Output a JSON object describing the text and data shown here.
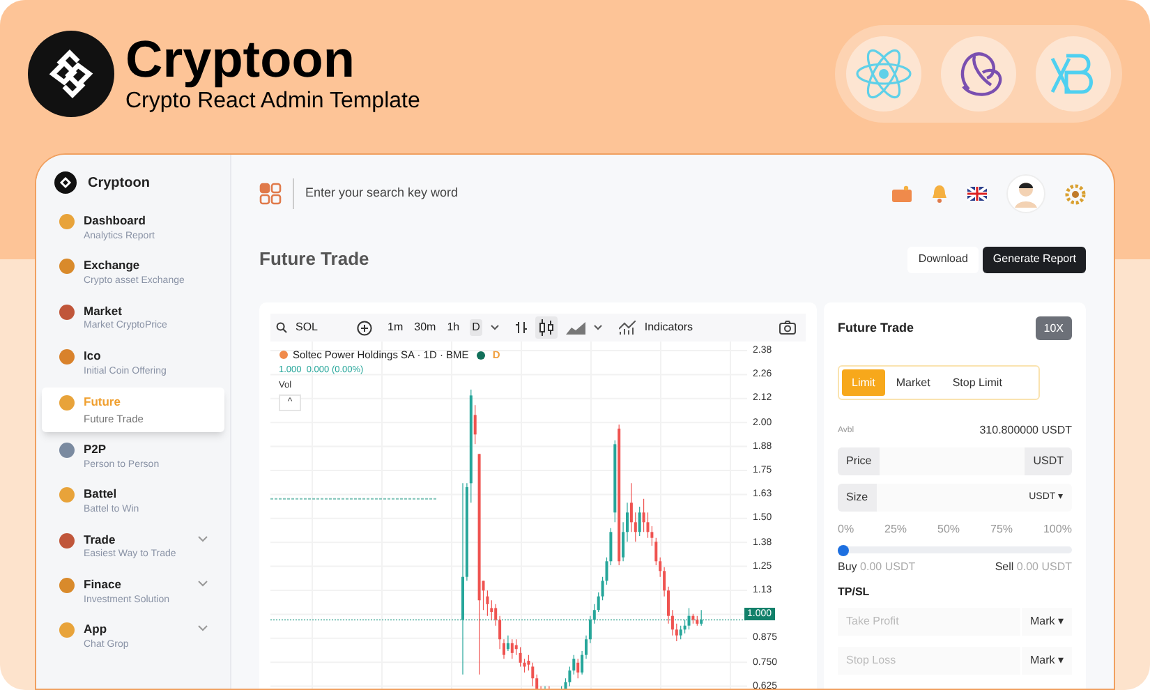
{
  "banner": {
    "title": "Cryptoon",
    "subtitle": "Crypto React Admin Template"
  },
  "app": {
    "brand": "Cryptoon",
    "sidebar": {
      "items": [
        {
          "title": "Dashboard",
          "subtitle": "Analytics Report",
          "selected": false,
          "kind": "link",
          "color": "#e8a33a"
        },
        {
          "title": "Exchange",
          "subtitle": "Crypto asset Exchange",
          "selected": false,
          "kind": "link",
          "color": "#d98a2b"
        },
        {
          "title": "Market",
          "subtitle": "Market CryptoPrice",
          "selected": false,
          "kind": "link",
          "color": "#c0563a"
        },
        {
          "title": "Ico",
          "subtitle": "Initial Coin Offering",
          "selected": false,
          "kind": "link",
          "color": "#d9822b"
        },
        {
          "title": "Future",
          "subtitle": "Future Trade",
          "selected": true,
          "kind": "link",
          "color": "#e8a33a"
        },
        {
          "title": "P2P",
          "subtitle": "Person to Person",
          "selected": false,
          "kind": "link",
          "color": "#7a8aa0"
        },
        {
          "title": "Battel",
          "subtitle": "Battel to Win",
          "selected": false,
          "kind": "link",
          "color": "#e8a33a"
        },
        {
          "title": "Trade",
          "subtitle": "Easiest Way to Trade",
          "selected": false,
          "kind": "group",
          "color": "#c0563a"
        },
        {
          "title": "Finace",
          "subtitle": "Investment Solution",
          "selected": false,
          "kind": "group",
          "color": "#d98a2b"
        },
        {
          "title": "App",
          "subtitle": "Chat Grop",
          "selected": false,
          "kind": "group",
          "color": "#e8a33a"
        }
      ]
    },
    "search": {
      "placeholder": "Enter your search key word"
    },
    "page_title": "Future Trade",
    "buttons": [
      "Download",
      "Generate Report"
    ],
    "chart": {
      "symbol": "SOL",
      "intervals": [
        {
          "label": "1m",
          "selected": false
        },
        {
          "label": "30m",
          "selected": false
        },
        {
          "label": "1h",
          "selected": false
        },
        {
          "label": "D",
          "selected": true
        }
      ],
      "indicators": "Indicators",
      "legend": "Soltec Power Holdings SA · 1D · BME",
      "legend_badge": "D",
      "quote": "1.000  0.000 (0.00%)",
      "volume": "Vol",
      "collapse": "^",
      "price_labels": [
        "2.38",
        "2.26",
        "2.12",
        "2.00",
        "1.88",
        "1.75",
        "1.63",
        "1.50",
        "1.38",
        "1.25",
        "1.13",
        "0.875",
        "0.750",
        "0.625"
      ],
      "last_price": "1.000"
    },
    "order": {
      "title": "Future Trade",
      "leverage": "10X",
      "tabs": [
        {
          "label": "Limit",
          "selected": true
        },
        {
          "label": "Market",
          "selected": false
        },
        {
          "label": "Stop Limit",
          "selected": false
        }
      ],
      "avbl_label": "Avbl",
      "avbl_value": "310.800000 USDT",
      "price_label": "Price",
      "price_unit": "USDT",
      "size_label": "Size",
      "size_unit": "USDT ▾",
      "steps": [
        "0%",
        "25%",
        "50%",
        "75%",
        "100%"
      ],
      "slider": {
        "level": 0
      },
      "buy_label": "Buy",
      "buy_value": "0.00 USDT",
      "sell_label": "Sell",
      "sell_value": "0.00 USDT",
      "tpsl": "TP/SL",
      "tp": {
        "placeholder": "Take Profit",
        "unit": "Mark ▾"
      },
      "sl": {
        "placeholder": "Stop Loss",
        "unit": "Mark ▾"
      }
    }
  }
}
